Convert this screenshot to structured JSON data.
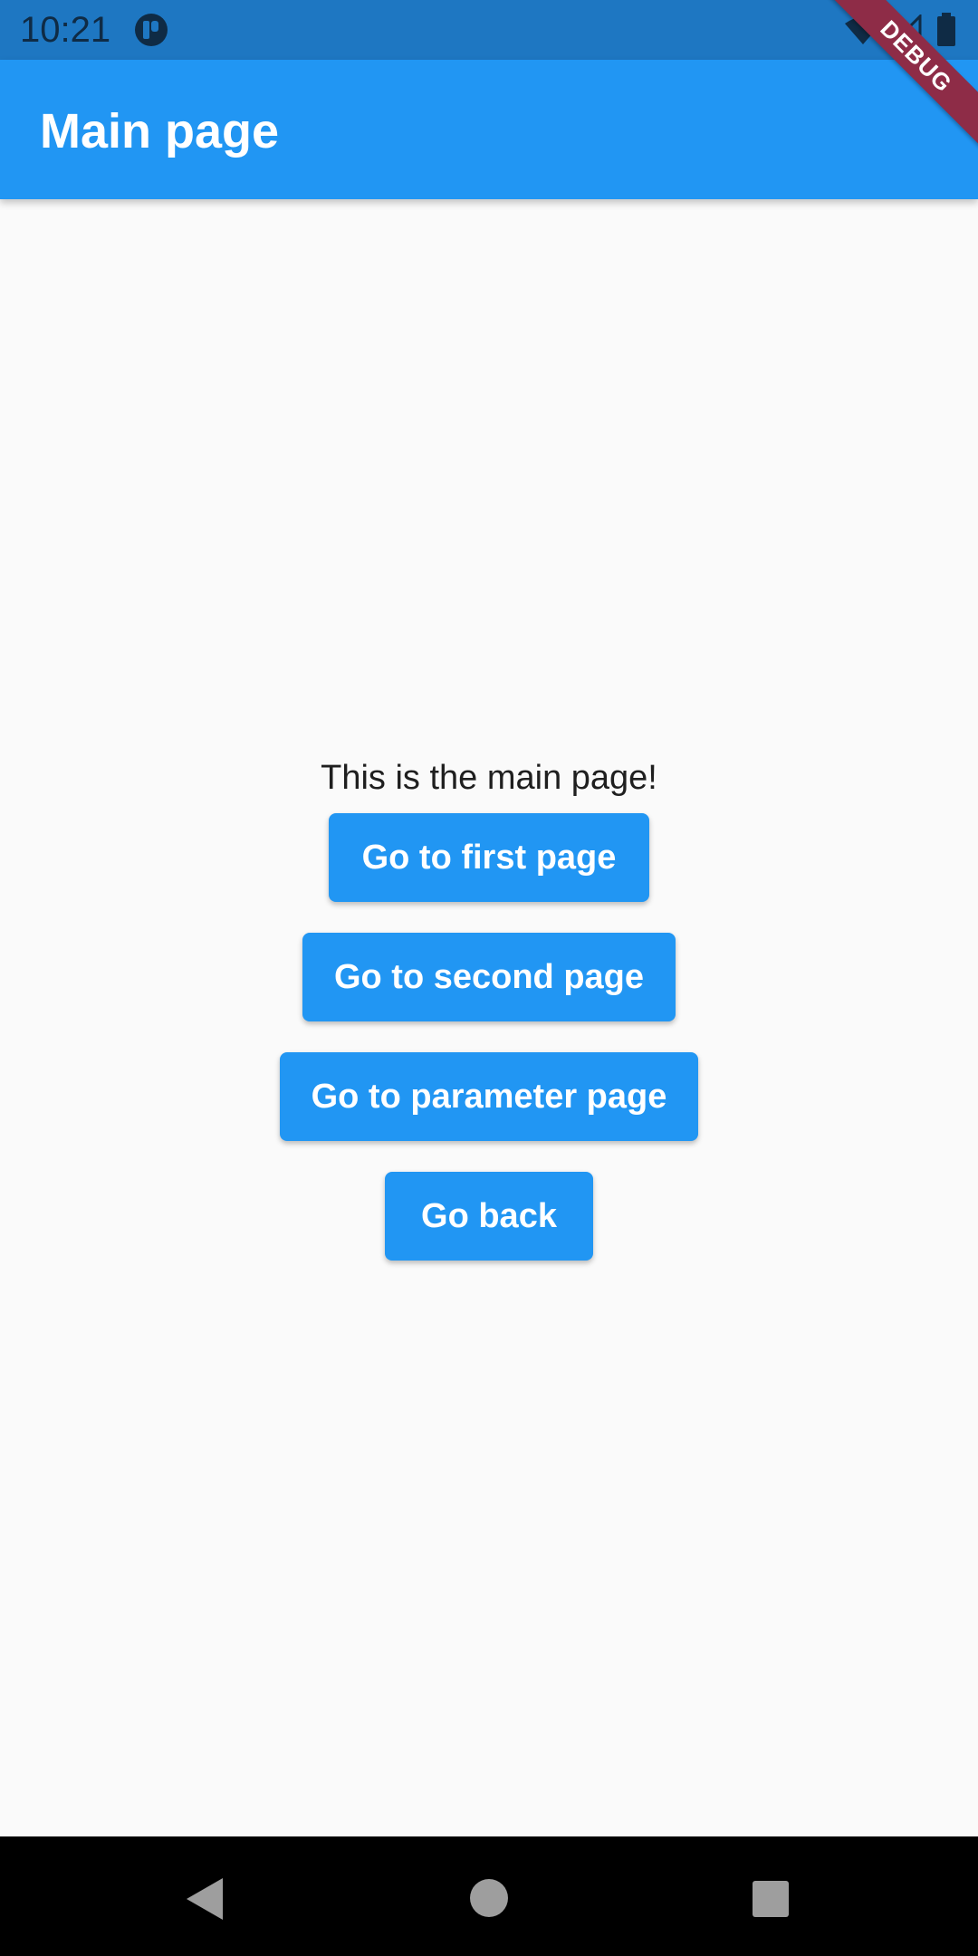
{
  "status_bar": {
    "time": "10:21",
    "icons": [
      "app-notification-icon",
      "wifi-icon",
      "cell-signal-icon",
      "battery-icon"
    ],
    "color": "#1e77c2"
  },
  "debug_banner": {
    "label": "DEBUG",
    "color": "#8e2c47"
  },
  "app_bar": {
    "title": "Main page",
    "color": "#2196f3"
  },
  "main": {
    "message": "This is the main page!",
    "buttons": [
      {
        "label": "Go to first page"
      },
      {
        "label": "Go to second page"
      },
      {
        "label": "Go to parameter page"
      },
      {
        "label": "Go back"
      }
    ],
    "button_color": "#2196f3"
  },
  "nav_bar": {
    "icons": [
      "back-icon",
      "home-icon",
      "recents-icon"
    ]
  }
}
